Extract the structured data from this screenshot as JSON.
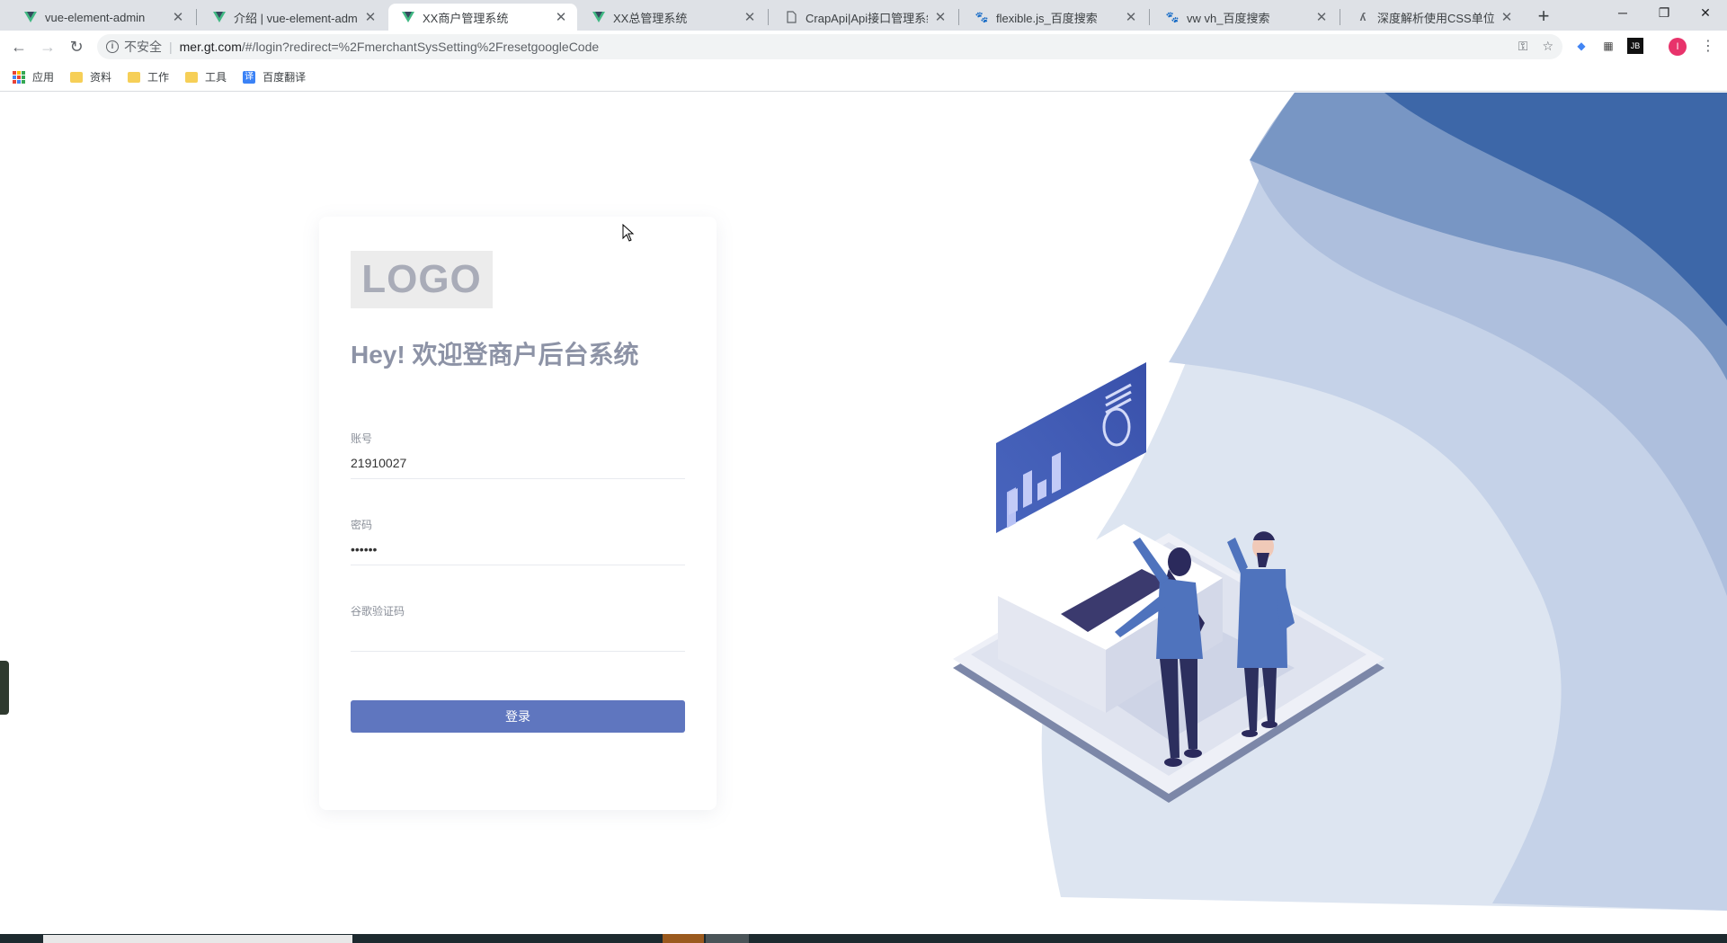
{
  "browser": {
    "tabs": [
      {
        "title": "vue-element-admin",
        "icon": "vue-icon",
        "active": false
      },
      {
        "title": "介绍 | vue-element-admin",
        "icon": "vue-icon",
        "active": false
      },
      {
        "title": "XX商户管理系统",
        "icon": "vue-icon",
        "active": true
      },
      {
        "title": "XX总管理系统",
        "icon": "vue-icon",
        "active": false
      },
      {
        "title": "CrapApi|Api接口管理系统",
        "icon": "document-icon",
        "active": false
      },
      {
        "title": "flexible.js_百度搜索",
        "icon": "baidu-paw-icon",
        "active": false
      },
      {
        "title": "vw vh_百度搜索",
        "icon": "baidu-paw-icon",
        "active": false
      },
      {
        "title": "深度解析使用CSS单位px、",
        "icon": "zhihu-icon",
        "active": false
      }
    ],
    "security_label": "不安全",
    "url_host": "mer.gt.com",
    "url_path": "/#/login?redirect=%2FmerchantSysSetting%2FresetgoogleCode",
    "profile_initial": "I",
    "bookmarks": [
      {
        "label": "应用",
        "icon": "apps-grid-icon"
      },
      {
        "label": "资料",
        "icon": "folder-icon"
      },
      {
        "label": "工作",
        "icon": "folder-icon"
      },
      {
        "label": "工具",
        "icon": "folder-icon"
      },
      {
        "label": "百度翻译",
        "icon": "translate-icon"
      }
    ]
  },
  "login": {
    "logo_text": "LOGO",
    "welcome": "Hey! 欢迎登商户后台系统",
    "account_label": "账号",
    "account_value": "21910027",
    "password_label": "密码",
    "password_value": "••••••",
    "google_code_label": "谷歌验证码",
    "google_code_value": "",
    "submit_label": "登录"
  },
  "colors": {
    "primary_button": "#5f76bf",
    "welcome_text": "#8d93a6",
    "wave_dark": "#3d67a8",
    "wave_mid": "#7896c4",
    "wave_light": "#aebfdd"
  }
}
